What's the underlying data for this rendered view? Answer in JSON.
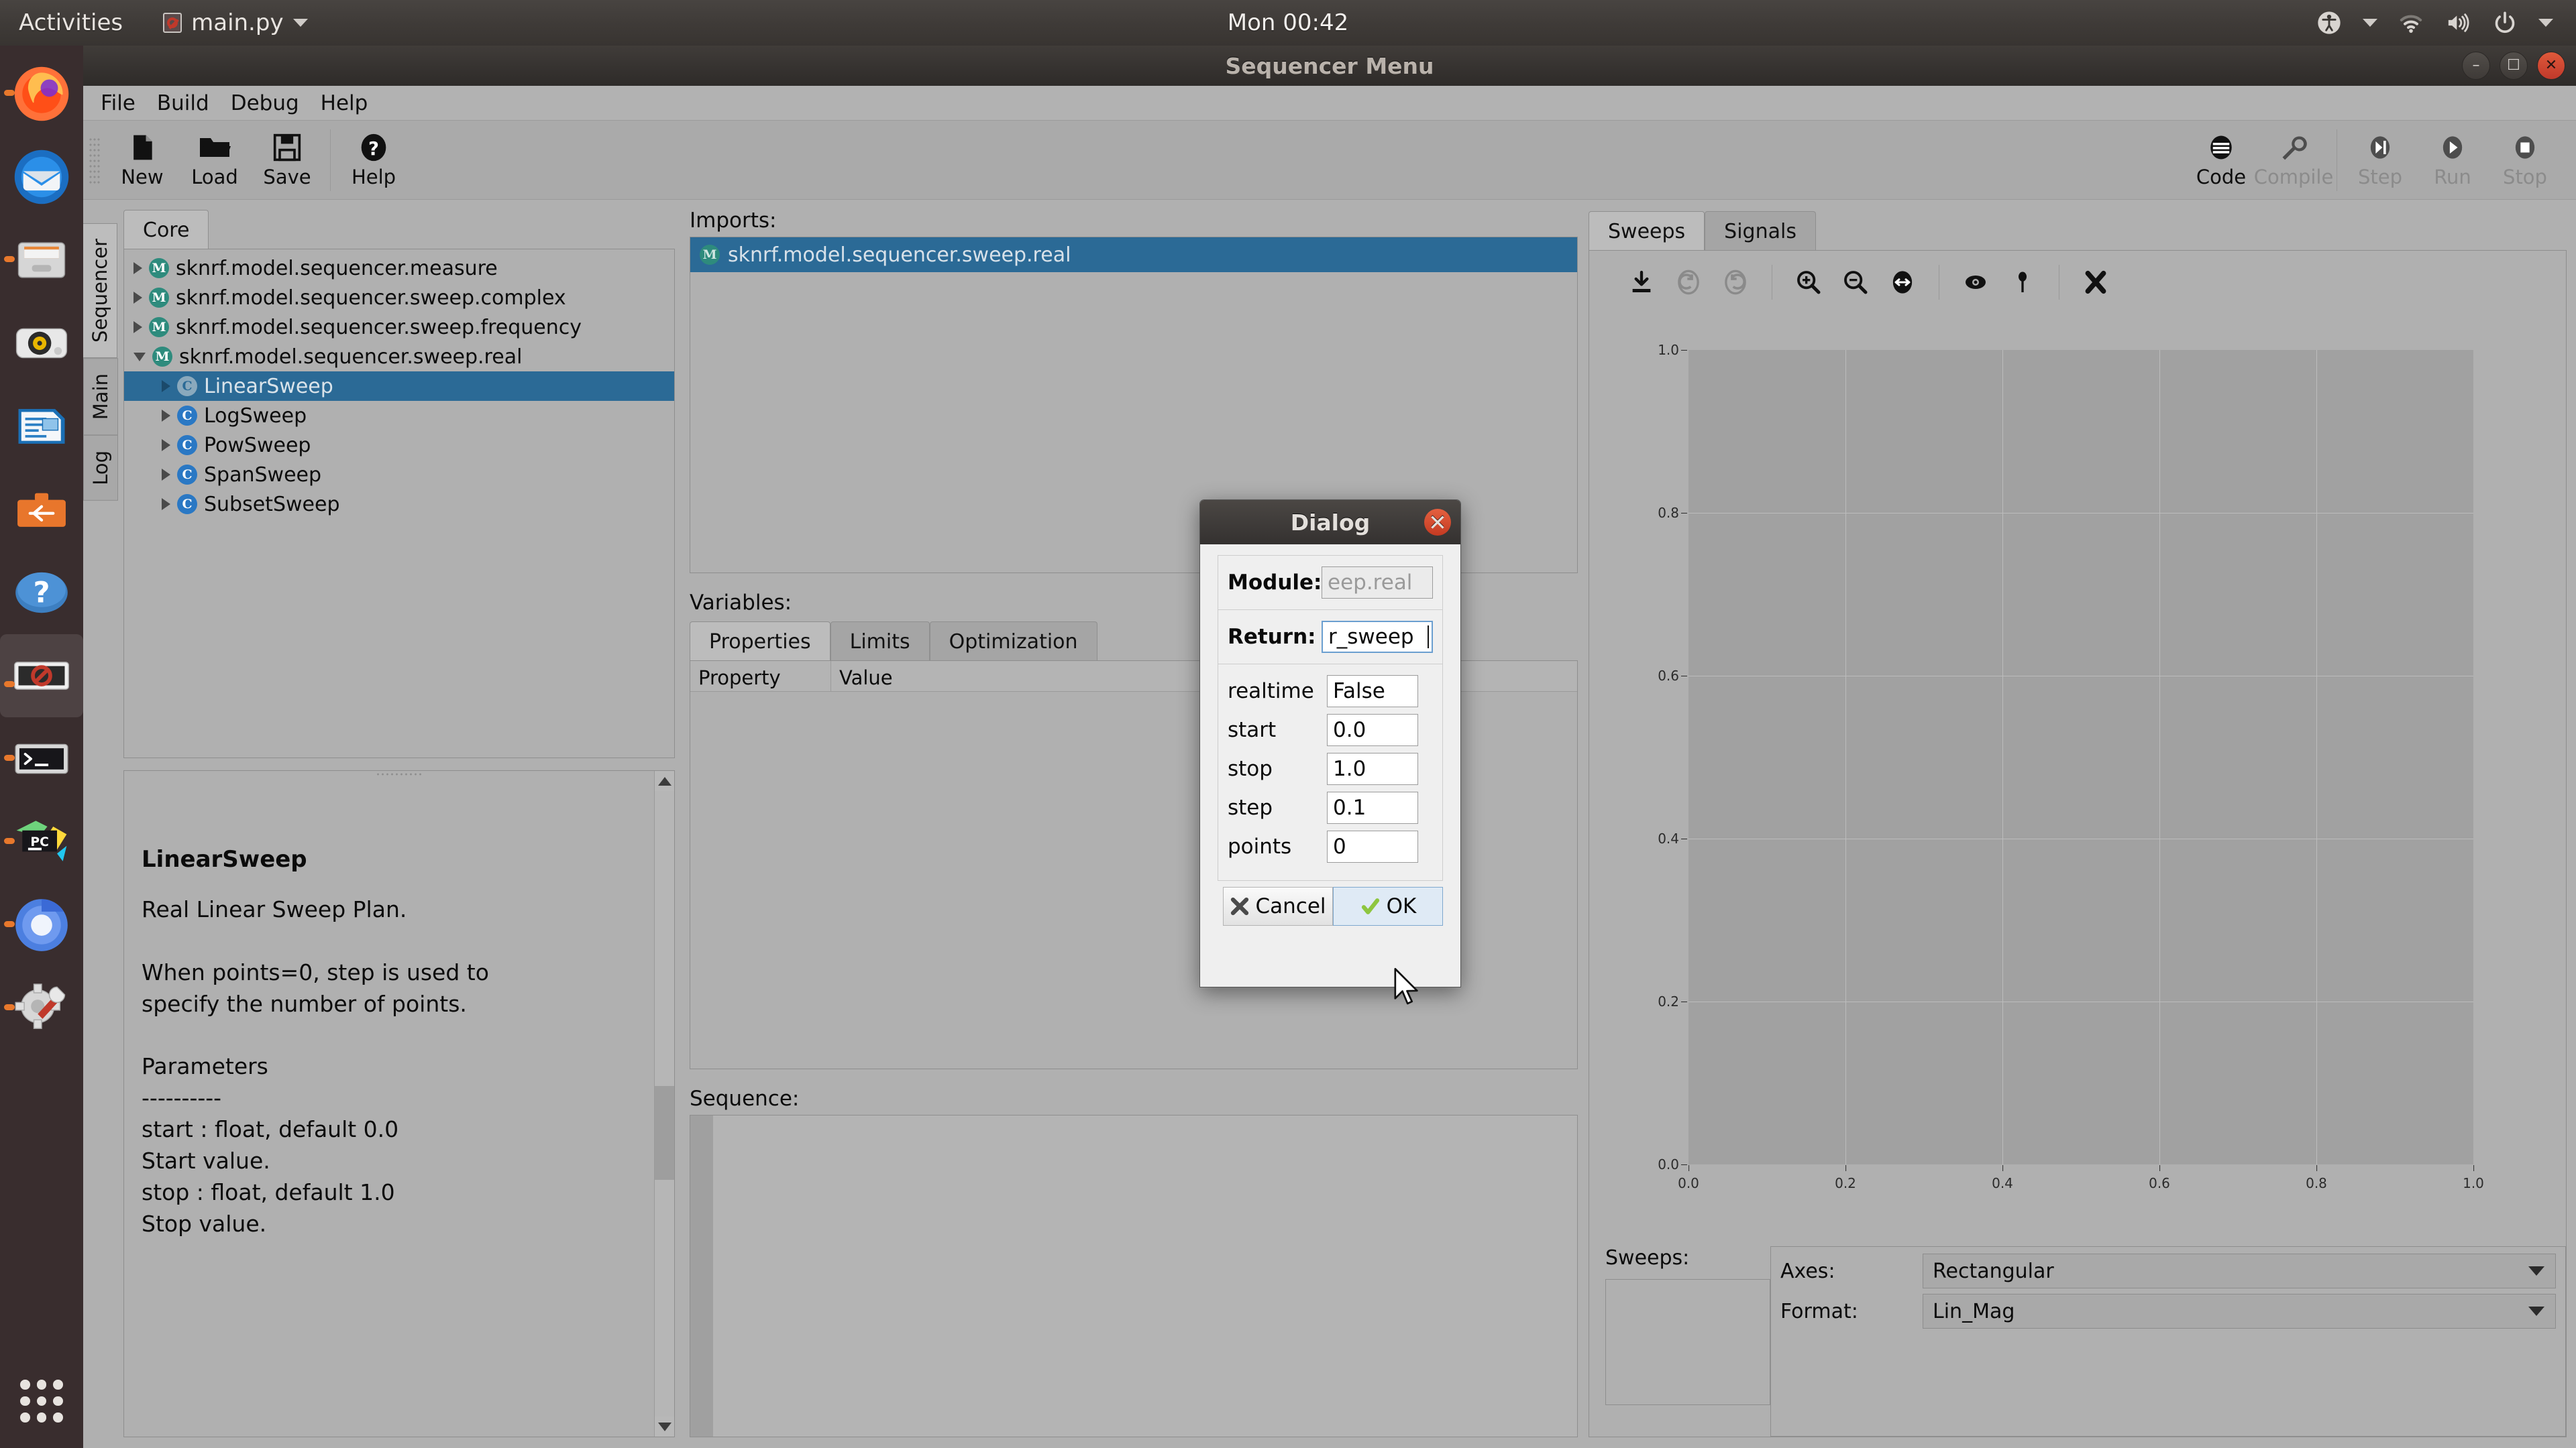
{
  "desktop": {
    "activities": "Activities",
    "app_name": "main.py",
    "clock": "Mon 00:42",
    "app_icon": "no-entry-icon",
    "system_icons": [
      "accessibility-icon",
      "chevron-down-icon",
      "wifi-icon",
      "volume-icon",
      "power-icon",
      "chevron-down-icon"
    ],
    "dock_items": [
      {
        "name": "firefox",
        "running": true
      },
      {
        "name": "thunderbird",
        "running": false
      },
      {
        "name": "files",
        "running": true
      },
      {
        "name": "rhythmbox",
        "running": false
      },
      {
        "name": "libreoffice-writer",
        "running": false
      },
      {
        "name": "ubuntu-software",
        "running": false
      },
      {
        "name": "help",
        "running": false
      },
      {
        "name": "sequencer-app",
        "running": true,
        "active": true
      },
      {
        "name": "terminal",
        "running": true
      },
      {
        "name": "pycharm",
        "running": true
      },
      {
        "name": "chromium",
        "running": true
      },
      {
        "name": "settings-tools",
        "running": true
      }
    ],
    "show_apps": "show-applications-icon"
  },
  "window": {
    "title": "Sequencer Menu",
    "controls": [
      "minimize",
      "maximize",
      "close"
    ]
  },
  "menubar": [
    "File",
    "Build",
    "Debug",
    "Help"
  ],
  "toolbar": {
    "left": [
      {
        "label": "New",
        "icon": "new-file-icon",
        "enabled": true
      },
      {
        "label": "Load",
        "icon": "open-folder-icon",
        "enabled": true
      },
      {
        "label": "Save",
        "icon": "floppy-disk-icon",
        "enabled": true
      },
      {
        "label": "Help",
        "icon": "question-mark-icon",
        "enabled": true
      }
    ],
    "right": [
      {
        "label": "Code",
        "icon": "code-lines-icon",
        "enabled": true
      },
      {
        "label": "Compile",
        "icon": "wrench-icon",
        "enabled": false
      },
      {
        "label": "Step",
        "icon": "step-forward-icon",
        "enabled": false
      },
      {
        "label": "Run",
        "icon": "play-icon",
        "enabled": false
      },
      {
        "label": "Stop",
        "icon": "stop-square-icon",
        "enabled": false
      }
    ]
  },
  "vertical_tabs": [
    {
      "label": "Sequencer",
      "active": true
    },
    {
      "label": "Main",
      "active": false
    },
    {
      "label": "Log",
      "active": false
    }
  ],
  "left_panel": {
    "tab": "Core",
    "tree": [
      {
        "label": "sknrf.model.sequencer.measure",
        "kind": "M",
        "depth": 0,
        "expanded": false,
        "selected": false
      },
      {
        "label": "sknrf.model.sequencer.sweep.complex",
        "kind": "M",
        "depth": 0,
        "expanded": false,
        "selected": false
      },
      {
        "label": "sknrf.model.sequencer.sweep.frequency",
        "kind": "M",
        "depth": 0,
        "expanded": false,
        "selected": false
      },
      {
        "label": "sknrf.model.sequencer.sweep.real",
        "kind": "M",
        "depth": 0,
        "expanded": true,
        "selected": false
      },
      {
        "label": "LinearSweep",
        "kind": "C",
        "depth": 1,
        "expanded": false,
        "selected": true
      },
      {
        "label": "LogSweep",
        "kind": "C",
        "depth": 1,
        "expanded": false,
        "selected": false
      },
      {
        "label": "PowSweep",
        "kind": "C",
        "depth": 1,
        "expanded": false,
        "selected": false
      },
      {
        "label": "SpanSweep",
        "kind": "C",
        "depth": 1,
        "expanded": false,
        "selected": false
      },
      {
        "label": "SubsetSweep",
        "kind": "C",
        "depth": 1,
        "expanded": false,
        "selected": false
      }
    ],
    "doc": {
      "heading": "LinearSweep",
      "body": "Real Linear Sweep Plan.\n\nWhen points=0, step is used to\nspecify the number of points.\n\nParameters\n----------\nstart : float, default 0.0\nStart value.\nstop : float, default 1.0\nStop value."
    }
  },
  "center_panel": {
    "imports_label": "Imports:",
    "imports": [
      {
        "label": "sknrf.model.sequencer.sweep.real",
        "kind": "M",
        "selected": true
      }
    ],
    "variables_label": "Variables:",
    "variables_tabs": [
      {
        "label": "Properties",
        "active": true
      },
      {
        "label": "Limits",
        "active": false
      },
      {
        "label": "Optimization",
        "active": false
      }
    ],
    "variables_columns": [
      "Property",
      "Value"
    ],
    "variables_rows": [],
    "sequence_label": "Sequence:"
  },
  "right_panel": {
    "tabs": [
      {
        "label": "Sweeps",
        "active": true
      },
      {
        "label": "Signals",
        "active": false
      }
    ],
    "plot_toolbar": [
      {
        "name": "save-icon",
        "enabled": true
      },
      {
        "name": "undo-icon",
        "enabled": false
      },
      {
        "name": "redo-icon",
        "enabled": false
      },
      {
        "name": "zoom-in-icon",
        "enabled": true
      },
      {
        "name": "zoom-out-icon",
        "enabled": true
      },
      {
        "name": "autoscale-icon",
        "enabled": true
      },
      {
        "name": "visibility-eye-icon",
        "enabled": true
      },
      {
        "name": "marker-pin-icon",
        "enabled": true
      },
      {
        "name": "clear-x-icon",
        "enabled": true
      }
    ],
    "sweeps_label": "Sweeps:",
    "sweeps_items": [],
    "axes_label": "Axes:",
    "axes_value": "Rectangular",
    "format_label": "Format:",
    "format_value": "Lin_Mag"
  },
  "chart_data": {
    "type": "line",
    "title": "",
    "xlabel": "",
    "ylabel": "",
    "xlim": [
      0.0,
      1.0
    ],
    "ylim": [
      0.0,
      1.0
    ],
    "xticks": [
      "0.0",
      "0.2",
      "0.4",
      "0.6",
      "0.8",
      "1.0"
    ],
    "yticks": [
      "0.0",
      "0.2",
      "0.4",
      "0.6",
      "0.8",
      "1.0"
    ],
    "grid": true,
    "legend": null,
    "series": []
  },
  "dialog": {
    "title": "Dialog",
    "close_icon": "close-icon",
    "module_label": "Module:",
    "module_value": "eep.real",
    "return_label": "Return:",
    "return_value": "r_sweep",
    "params": [
      {
        "label": "realtime",
        "value": "False"
      },
      {
        "label": "start",
        "value": "0.0"
      },
      {
        "label": "stop",
        "value": "1.0"
      },
      {
        "label": "step",
        "value": "0.1"
      },
      {
        "label": "points",
        "value": "0"
      }
    ],
    "cancel_label": "Cancel",
    "ok_label": "OK"
  },
  "colors": {
    "selection": "#2b6a96",
    "module_badge": "#2e8b7d",
    "class_badge": "#2a78c4",
    "accent_orange": "#e8782c",
    "close_red": "#c0392b"
  }
}
